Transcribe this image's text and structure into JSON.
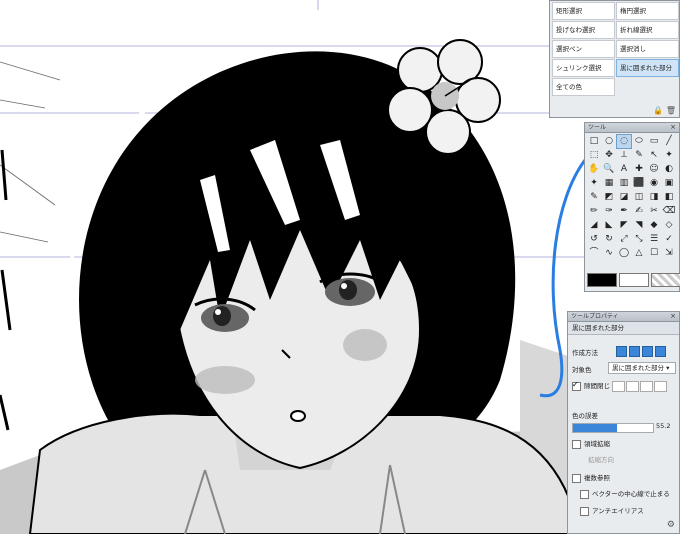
{
  "colors": {
    "accent": "#3b86d8",
    "panel_bg": "#e9ecef",
    "highlight_blue": "#cfe4f7",
    "selection_outline": "#2a7de1"
  },
  "selection_panel": {
    "items": [
      [
        "矩形選択",
        "楕円選択"
      ],
      [
        "投げなわ選択",
        "折れ線選択"
      ],
      [
        "選択ペン",
        "選択消し"
      ],
      [
        "シュリンク選択",
        "黒に囲まれた部分"
      ],
      [
        "全ての色",
        ""
      ]
    ],
    "active": "黒に囲まれた部分",
    "footer_icons": [
      "lock-icon",
      "trash-icon"
    ]
  },
  "tool_palette": {
    "title": "ツール",
    "tools": [
      "□",
      "○",
      "◌",
      "⬭",
      "▭",
      "╱",
      "⬚",
      "✥",
      "⟂",
      "✎",
      "↖",
      "✦",
      "✋",
      "🔍",
      "A",
      "✚",
      "☺",
      "◐",
      "✦",
      "▦",
      "▥",
      "⬛",
      "◉",
      "▣",
      "✎",
      "◩",
      "◪",
      "◫",
      "◨",
      "◧",
      "✏",
      "✑",
      "✒",
      "✍",
      "✂",
      "⌫",
      "◢",
      "◣",
      "◤",
      "◥",
      "◆",
      "◇",
      "↺",
      "↻",
      "⤢",
      "⤡",
      "☰",
      "✓",
      "⌒",
      "∿",
      "◯",
      "△",
      "☐",
      "⇲"
    ]
  },
  "tool_property": {
    "title": "ツールプロパティ",
    "tool_name": "黒に囲まれた部分",
    "creation_method_label": "作成方法",
    "target_color_label": "対象色",
    "target_color_value": "黒に囲まれた部分",
    "close_gap_label": "隙間閉じ",
    "close_gap_checked": true,
    "color_tolerance_label": "色の誤差",
    "color_tolerance_value": "55.2",
    "expand_label": "領域拡縮",
    "expand_checked": false,
    "expand_width_label": "拡縮方向",
    "multi_ref_label": "複数参照",
    "multi_ref_checked": false,
    "vector_stop_label": "ベクターの中心線で止まる",
    "vector_stop_checked": false,
    "antialias_label": "アンチエイリアス",
    "antialias_checked": false,
    "tolerance_fraction": 0.55
  }
}
